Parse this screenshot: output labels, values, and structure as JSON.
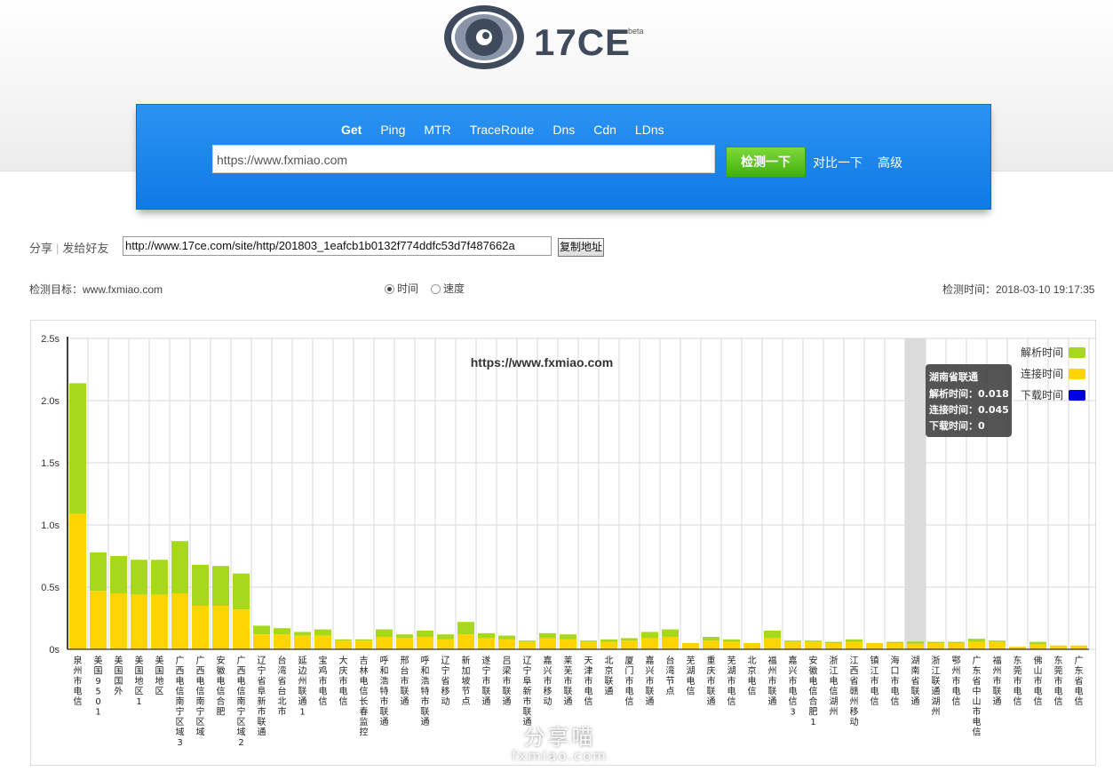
{
  "logo": {
    "text": "17CE",
    "badge": "beta"
  },
  "nav": {
    "tabs": [
      {
        "label": "Get",
        "active": true
      },
      {
        "label": "Ping"
      },
      {
        "label": "MTR"
      },
      {
        "label": "TraceRoute"
      },
      {
        "label": "Dns"
      },
      {
        "label": "Cdn"
      },
      {
        "label": "LDns"
      }
    ]
  },
  "search": {
    "url_value": "https://www.fxmiao.com",
    "check_button": "检测一下",
    "compare_link": "对比一下",
    "advanced_link": "高级"
  },
  "share": {
    "label": "分享",
    "send_label": "发给好友",
    "url": "http://www.17ce.com/site/http/201803_1eafcb1b0132f774ddfc53d7f487662a",
    "copy_button": "复制地址"
  },
  "info": {
    "target_label": "检测目标：www.fxmiao.com",
    "radio_time": "时间",
    "radio_speed": "速度",
    "check_time": "检测时间：2018-03-10 19:17:35"
  },
  "colors": {
    "resolve": "#a8d81b",
    "connect": "#ffd400",
    "download": "#0000e0",
    "accent": "#1a86ea"
  },
  "chart_data": {
    "type": "bar",
    "title": "https://www.fxmiao.com",
    "ylim": [
      0,
      2.5
    ],
    "yticks": [
      "0s",
      "0.5s",
      "1.0s",
      "1.5s",
      "2.0s",
      "2.5s"
    ],
    "stacked": true,
    "legend_position": "top-right",
    "categories": [
      "泉州市电信",
      "美国9501",
      "美国国外",
      "美国地区1",
      "美国地区",
      "广西电信南宁区域3",
      "广西电信南宁区域",
      "安徽电信合肥",
      "广西电信南宁区域2",
      "辽宁省阜新市联通",
      "台湾省台北市",
      "延边州联通1",
      "宝鸡市电信",
      "大庆市电信",
      "吉林电信长春监控",
      "呼和浩特市联通",
      "邢台市联通",
      "呼和浩特市联通",
      "辽宁省移动",
      "新加坡节点",
      "遂宁市联通",
      "吕梁市联通",
      "辽宁阜新市联通",
      "嘉兴市移动",
      "莱芜市联通",
      "天津市电信",
      "北京联通",
      "厦门市电信",
      "嘉兴市联通",
      "台湾节点",
      "芜湖电信",
      "重庆市联通",
      "芜湖市电信",
      "北京电信",
      "福州市联通",
      "嘉兴市电信3",
      "安徽电信合肥1",
      "浙江电信湖州",
      "江西省赣州移动",
      "镇江市电信",
      "海口市电信",
      "湖南省联通",
      "浙江联通湖州",
      "鄂州市电信",
      "广东省中山市电信",
      "福州市联通",
      "东莞市电信",
      "佛山市电信",
      "东莞市电信",
      "广东省电信"
    ],
    "series": [
      {
        "name": "连接时间",
        "values": [
          1.09,
          0.47,
          0.45,
          0.44,
          0.44,
          0.45,
          0.35,
          0.35,
          0.32,
          0.12,
          0.12,
          0.11,
          0.11,
          0.07,
          0.07,
          0.1,
          0.09,
          0.1,
          0.08,
          0.12,
          0.09,
          0.08,
          0.06,
          0.09,
          0.08,
          0.06,
          0.06,
          0.07,
          0.09,
          0.1,
          0.05,
          0.07,
          0.06,
          0.05,
          0.09,
          0.06,
          0.06,
          0.05,
          0.06,
          0.05,
          0.05,
          0.045,
          0.05,
          0.05,
          0.06,
          0.06,
          0.02,
          0.04,
          0.03,
          0.03
        ]
      },
      {
        "name": "解析时间",
        "values": [
          1.05,
          0.31,
          0.3,
          0.28,
          0.28,
          0.42,
          0.33,
          0.32,
          0.29,
          0.07,
          0.05,
          0.03,
          0.05,
          0.01,
          0.01,
          0.06,
          0.03,
          0.05,
          0.04,
          0.1,
          0.04,
          0.03,
          0.01,
          0.04,
          0.04,
          0.01,
          0.02,
          0.02,
          0.05,
          0.06,
          0.0,
          0.03,
          0.02,
          0.0,
          0.06,
          0.01,
          0.01,
          0.01,
          0.02,
          0.0,
          0.01,
          0.018,
          0.01,
          0.01,
          0.025,
          0.01,
          0.0,
          0.02,
          0.0,
          0.0
        ]
      },
      {
        "name": "下载时间",
        "values": [
          0,
          0,
          0,
          0,
          0,
          0,
          0,
          0,
          0,
          0,
          0,
          0,
          0,
          0,
          0,
          0,
          0,
          0,
          0,
          0,
          0,
          0,
          0,
          0,
          0,
          0,
          0,
          0,
          0,
          0,
          0,
          0,
          0,
          0,
          0,
          0,
          0,
          0,
          0,
          0,
          0,
          0,
          0,
          0,
          0,
          0,
          0,
          0,
          0,
          0
        ]
      }
    ],
    "tooltip": {
      "title": "湖南省联通",
      "lines": [
        "解析时间：0.018",
        "连接时间：0.045",
        "下载时间：0"
      ],
      "category_index": 41
    }
  },
  "watermark": {
    "line1": "分享喵",
    "line2": "fxmiao.com"
  }
}
